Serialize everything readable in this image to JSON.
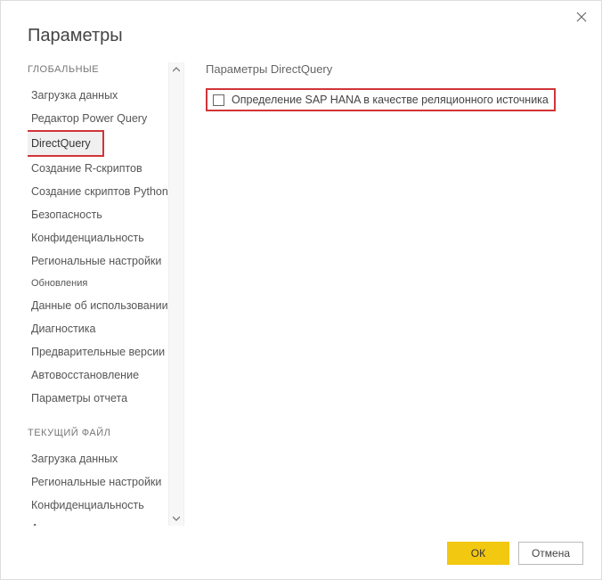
{
  "dialog": {
    "title": "Параметры"
  },
  "sidebar": {
    "section1_header": "ГЛОБАЛЬНЫЕ",
    "section2_header": "ТЕКУЩИЙ ФАЙЛ",
    "global_items": [
      "Загрузка данных",
      "Редактор Power Query",
      "DirectQuery",
      "Создание R-скриптов",
      "Создание скриптов Python",
      "Безопасность",
      "Конфиденциальность",
      "Региональные настройки",
      "Обновления",
      "Данные об использовании",
      "Диагностика",
      "Предварительные версии функций",
      "Автовосстановление",
      "Параметры отчета"
    ],
    "file_items": [
      "Загрузка данных",
      "Региональные настройки",
      "Конфиденциальность",
      "Автовосстановление"
    ]
  },
  "main": {
    "heading": "Параметры DirectQuery",
    "checkbox_label": "Определение SAP HANA в качестве реляционного источника"
  },
  "footer": {
    "ok": "ОК",
    "cancel": "Отмена"
  }
}
